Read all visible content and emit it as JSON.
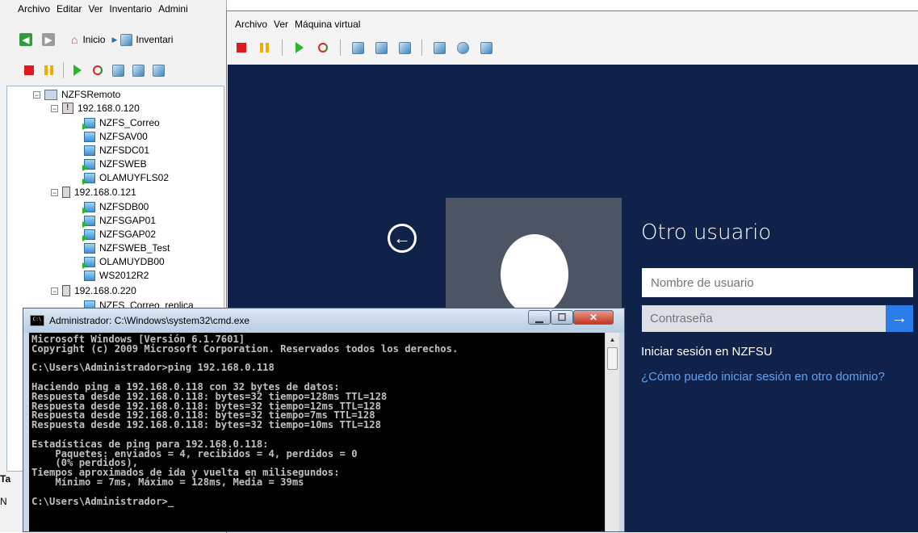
{
  "vsphere": {
    "menu": [
      "Archivo",
      "Editar",
      "Ver",
      "Inventario",
      "Admini"
    ],
    "breadcrumb": [
      "Inicio",
      "Inventari"
    ],
    "tree": {
      "root": "NZFSRemoto",
      "hosts": [
        {
          "name": "192.168.0.120",
          "vms": [
            "NZFS_Correo",
            "NZFSAV00",
            "NZFSDC01",
            "NZFSWEB",
            "OLAMUYFLS02"
          ]
        },
        {
          "name": "192.168.0.121",
          "vms": [
            "NZFSDB00",
            "NZFSGAP01",
            "NZFSGAP02",
            "NZFSWEB_Test",
            "OLAMUYDB00",
            "WS2012R2"
          ]
        },
        {
          "name": "192.168.0.220",
          "vms": [
            "NZFS_Correo_replica"
          ]
        }
      ]
    },
    "side_fragments": [
      "Ta",
      "N"
    ]
  },
  "vm_console": {
    "menu": [
      "Archivo",
      "Ver",
      "Máquina virtual"
    ]
  },
  "logon": {
    "title": "Otro usuario",
    "username_placeholder": "Nombre de usuario",
    "password_placeholder": "Contraseña",
    "signin_domain": "Iniciar sesión en NZFSU",
    "other_domain_link": "¿Cómo puedo iniciar sesión en otro dominio?",
    "background_color": "#10214a",
    "accent_color": "#2b7de9"
  },
  "cmd": {
    "title": "Administrador: C:\\Windows\\system32\\cmd.exe",
    "output": "Microsoft Windows [Versión 6.1.7601]\nCopyright (c) 2009 Microsoft Corporation. Reservados todos los derechos.\n\nC:\\Users\\Administrador>ping 192.168.0.118\n\nHaciendo ping a 192.168.0.118 con 32 bytes de datos:\nRespuesta desde 192.168.0.118: bytes=32 tiempo=128ms TTL=128\nRespuesta desde 192.168.0.118: bytes=32 tiempo=12ms TTL=128\nRespuesta desde 192.168.0.118: bytes=32 tiempo=7ms TTL=128\nRespuesta desde 192.168.0.118: bytes=32 tiempo=10ms TTL=128\n\nEstadísticas de ping para 192.168.0.118:\n    Paquetes: enviados = 4, recibidos = 4, perdidos = 0\n    (0% perdidos),\nTiempos aproximados de ida y vuelta en milisegundos:\n    Mínimo = 7ms, Máximo = 128ms, Media = 39ms\n\nC:\\Users\\Administrador>_"
  }
}
